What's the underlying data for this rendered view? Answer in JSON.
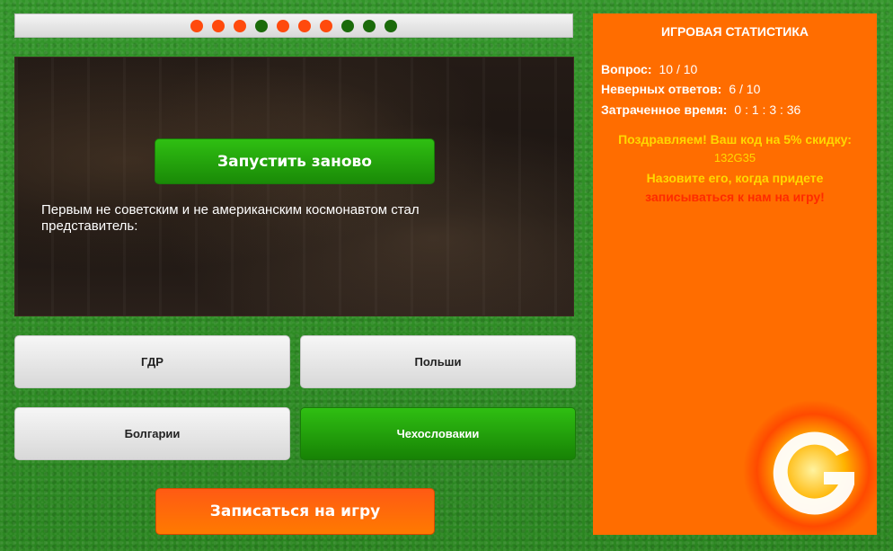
{
  "progress": {
    "dots": [
      "wrong",
      "wrong",
      "wrong",
      "right",
      "wrong",
      "wrong",
      "wrong",
      "right",
      "right",
      "right"
    ],
    "colors": {
      "wrong": "#ff4a0d",
      "right": "#1b6b0b"
    }
  },
  "question": {
    "restart_label": "Запустить заново",
    "text": "Первым не советским и не американским космонавтом стал представитель:"
  },
  "answers": [
    {
      "label": "ГДР",
      "state": "default"
    },
    {
      "label": "Польши",
      "state": "default"
    },
    {
      "label": "Болгарии",
      "state": "default"
    },
    {
      "label": "Чехословакии",
      "state": "correct"
    }
  ],
  "signup_label": "Записаться на игру",
  "stats": {
    "title": "ИГРОВАЯ СТАТИСТИКА",
    "question_label": "Вопрос:",
    "question_value": "10 / 10",
    "wrong_label": "Неверных ответов:",
    "wrong_value": "6 / 10",
    "time_label": "Затраченное время:",
    "time_value": "0 : 1 : 3 : 36",
    "promo_line1": "Поздравляем! Ваш код на 5% скидку:",
    "promo_code": "132G35",
    "promo_line3": "Назовите его, когда придете",
    "promo_line4": "записываться к нам на игру!"
  },
  "colors": {
    "accent_orange": "#ff6d00",
    "accent_green": "#1a8a07",
    "promo_yellow": "#ffd800",
    "promo_red": "#ff2a00"
  }
}
